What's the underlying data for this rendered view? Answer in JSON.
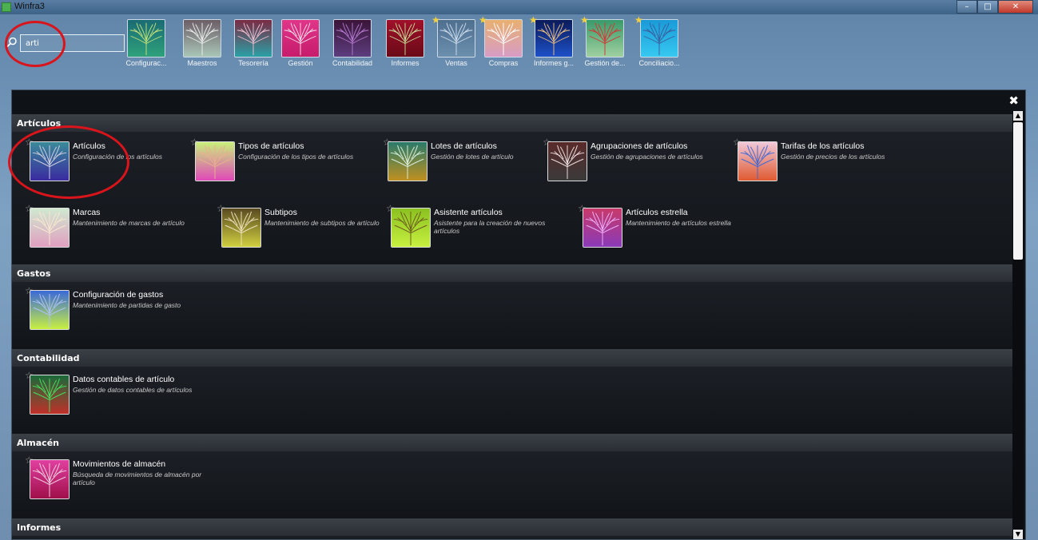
{
  "window": {
    "title": "Winfra3",
    "minimize": "–",
    "maximize": "□",
    "close": "✕"
  },
  "search": {
    "value": "arti",
    "placeholder": ""
  },
  "modules": [
    {
      "label": "Configurac...",
      "bg1": "#1a6b74",
      "bg2": "#2fa17a",
      "tree": "#c8e27a",
      "star": false
    },
    {
      "label": "Maestros",
      "bg1": "#6c5e66",
      "bg2": "#a9c6b8",
      "tree": "#f0f0f0",
      "star": false
    },
    {
      "label": "Tesorería",
      "bg1": "#7a2b44",
      "bg2": "#2aa0a6",
      "tree": "#f4c0d0",
      "star": false
    },
    {
      "label": "Gestión",
      "bg1": "#e0368a",
      "bg2": "#c71b6c",
      "tree": "#f2e0ea",
      "star": false
    },
    {
      "label": "Contabilidad",
      "bg1": "#3a1438",
      "bg2": "#5c3d7e",
      "tree": "#b67ad0",
      "star": false
    },
    {
      "label": "Informes",
      "bg1": "#a0102a",
      "bg2": "#6a0a18",
      "tree": "#c6e29a",
      "star": false
    },
    {
      "label": "Ventas",
      "bg1": "#4f6f8f",
      "bg2": "#6c8fae",
      "tree": "#d0e0f0",
      "star": true
    },
    {
      "label": "Compras",
      "bg1": "#e8b070",
      "bg2": "#d79cc6",
      "tree": "#ffffff",
      "star": true
    },
    {
      "label": "Informes g...",
      "bg1": "#0a1b5a",
      "bg2": "#1e50c8",
      "tree": "#f0c080",
      "star": true
    },
    {
      "label": "Gestión de...",
      "bg1": "#3a9a6a",
      "bg2": "#a0d0a0",
      "tree": "#d83030",
      "star": true
    },
    {
      "label": "Conciliacio...",
      "bg1": "#1a9ad8",
      "bg2": "#36c8f0",
      "tree": "#3a5a9a",
      "star": true
    }
  ],
  "sections": [
    {
      "title": "Artículos",
      "items": [
        {
          "title": "Artículos",
          "desc": "Configuración de los artículos",
          "bg1": "#3a8a9a",
          "bg2": "#3a2aa0",
          "tree": "#d0d0e0"
        },
        {
          "title": "Tipos de artículos",
          "desc": "Configuración de los tipos de artículos",
          "bg1": "#c8f07a",
          "bg2": "#e048b8",
          "tree": "#e8b090"
        },
        {
          "title": "Lotes de artículos",
          "desc": "Gestión de lotes de artículo",
          "bg1": "#2a7a6a",
          "bg2": "#c09020",
          "tree": "#d8f0e0"
        },
        {
          "title": "Agrupaciones de artículos",
          "desc": "Gestión de agrupaciones de artículos",
          "bg1": "#5a2a2a",
          "bg2": "#3a3a3a",
          "tree": "#f0e0e0"
        },
        {
          "title": "Tarifas de los artículos",
          "desc": "Gestión de precios de los artículos",
          "bg1": "#f0c8d8",
          "bg2": "#e05a30",
          "tree": "#3a6ad8"
        },
        {
          "title": "Marcas",
          "desc": "Mantenimiento de marcas de artículo",
          "bg1": "#d0e8d0",
          "bg2": "#e0a0c0",
          "tree": "#f8e8d0"
        },
        {
          "title": "Subtipos",
          "desc": "Mantenimiento de subtipos de artículo",
          "bg1": "#5a4a20",
          "bg2": "#d0d040",
          "tree": "#f0e0c0"
        },
        {
          "title": "Asistente artículos",
          "desc": "Asistente para la creación de nuevos artículos",
          "bg1": "#8ac020",
          "bg2": "#c8f040",
          "tree": "#6a5a20"
        },
        {
          "title": "Artículos estrella",
          "desc": "Mantenimiento de artículos estrella",
          "bg1": "#c83a6a",
          "bg2": "#8a3ab8",
          "tree": "#f0b0f8"
        }
      ]
    },
    {
      "title": "Gastos",
      "items": [
        {
          "title": "Configuración de gastos",
          "desc": "Mantenimiento de partidas de gasto",
          "bg1": "#3a6ad8",
          "bg2": "#c8f040",
          "tree": "#b0c0f8"
        }
      ]
    },
    {
      "title": "Contabilidad",
      "items": [
        {
          "title": "Datos contables de artículo",
          "desc": "Gestión de datos contables de artículos",
          "bg1": "#1a6a3a",
          "bg2": "#c0302a",
          "tree": "#40e060"
        }
      ]
    },
    {
      "title": "Almacén",
      "items": [
        {
          "title": "Movimientos de almacén",
          "desc": "Búsqueda de movimientos de almacén por artículo",
          "bg1": "#e040a0",
          "bg2": "#a0104a",
          "tree": "#f0d0e0"
        }
      ]
    },
    {
      "title": "Informes",
      "items": []
    }
  ],
  "panel_close": "✖"
}
